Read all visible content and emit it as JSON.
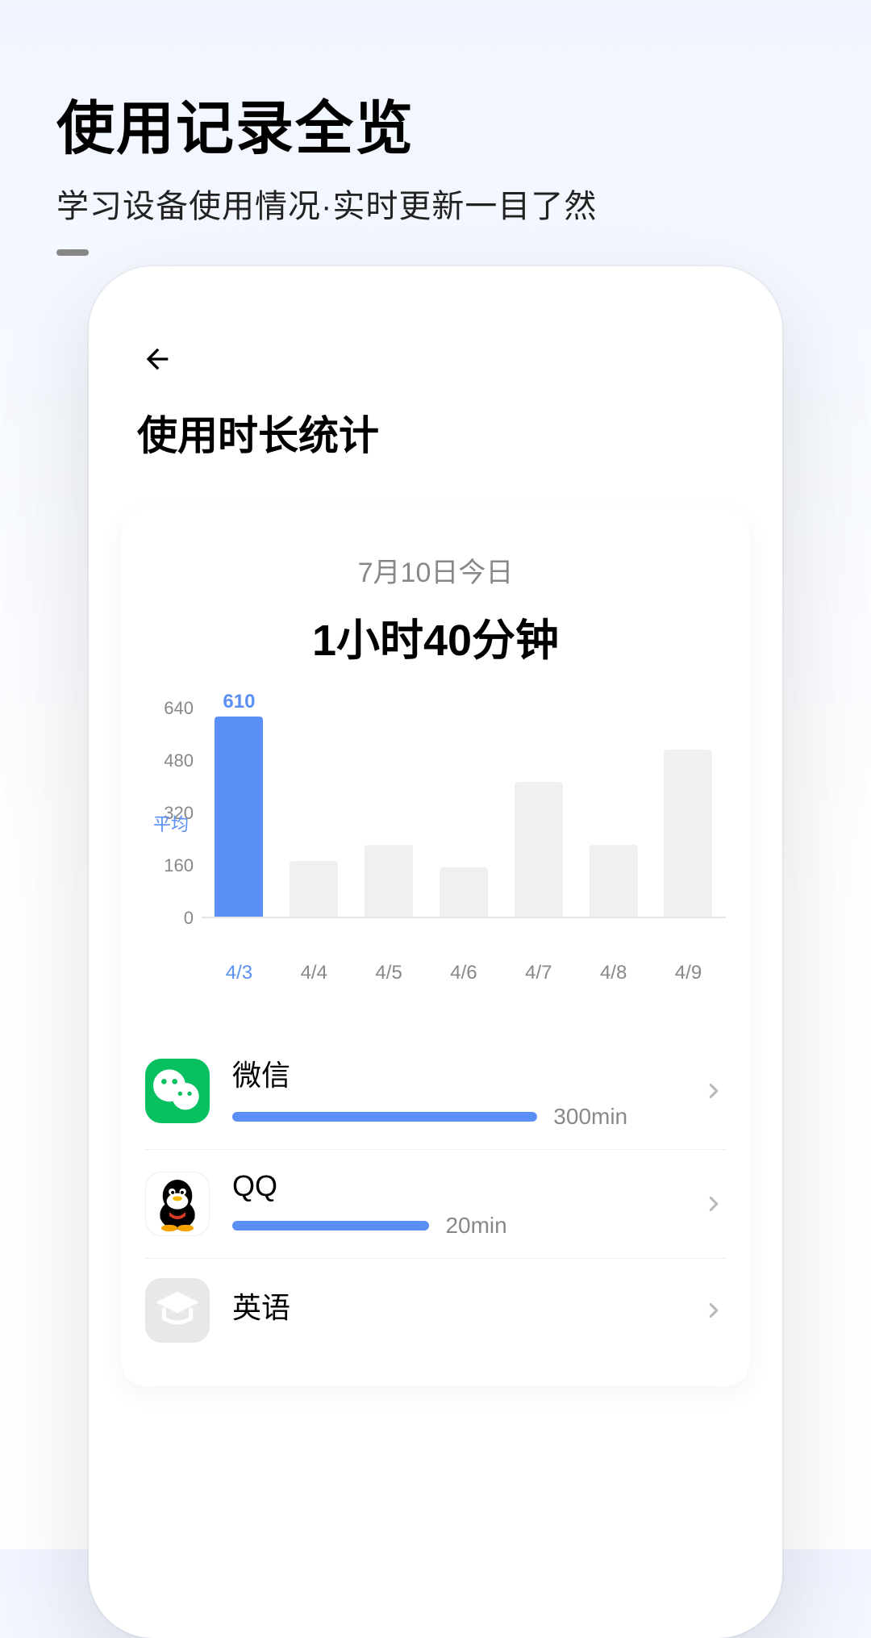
{
  "promo": {
    "title": "使用记录全览",
    "subtitle": "学习设备使用情况·实时更新一目了然"
  },
  "screen": {
    "title": "使用时长统计"
  },
  "stats": {
    "date_label": "7月10日今日",
    "total_label": "1小时40分钟"
  },
  "chart_data": {
    "type": "bar",
    "categories": [
      "4/3",
      "4/4",
      "4/5",
      "4/6",
      "4/7",
      "4/8",
      "4/9"
    ],
    "values": [
      610,
      170,
      220,
      150,
      410,
      220,
      510
    ],
    "selected_index": 0,
    "selected_value_label": "610",
    "y_ticks": [
      "640",
      "480",
      "320",
      "160",
      "0"
    ],
    "y_max": 640,
    "avg_label": "平均",
    "avg_value": 290,
    "xlabel": "",
    "ylabel": ""
  },
  "apps": [
    {
      "name": "微信",
      "duration_label": "300min",
      "progress_pct": 65,
      "icon": "wechat",
      "icon_bg": "#07c160"
    },
    {
      "name": "QQ",
      "duration_label": "20min",
      "progress_pct": 42,
      "icon": "qq",
      "icon_bg": "#ffffff"
    },
    {
      "name": "英语",
      "duration_label": "",
      "progress_pct": 0,
      "icon": "edu",
      "icon_bg": "#e8e8e8"
    }
  ],
  "colors": {
    "accent": "#5a8ff5"
  }
}
